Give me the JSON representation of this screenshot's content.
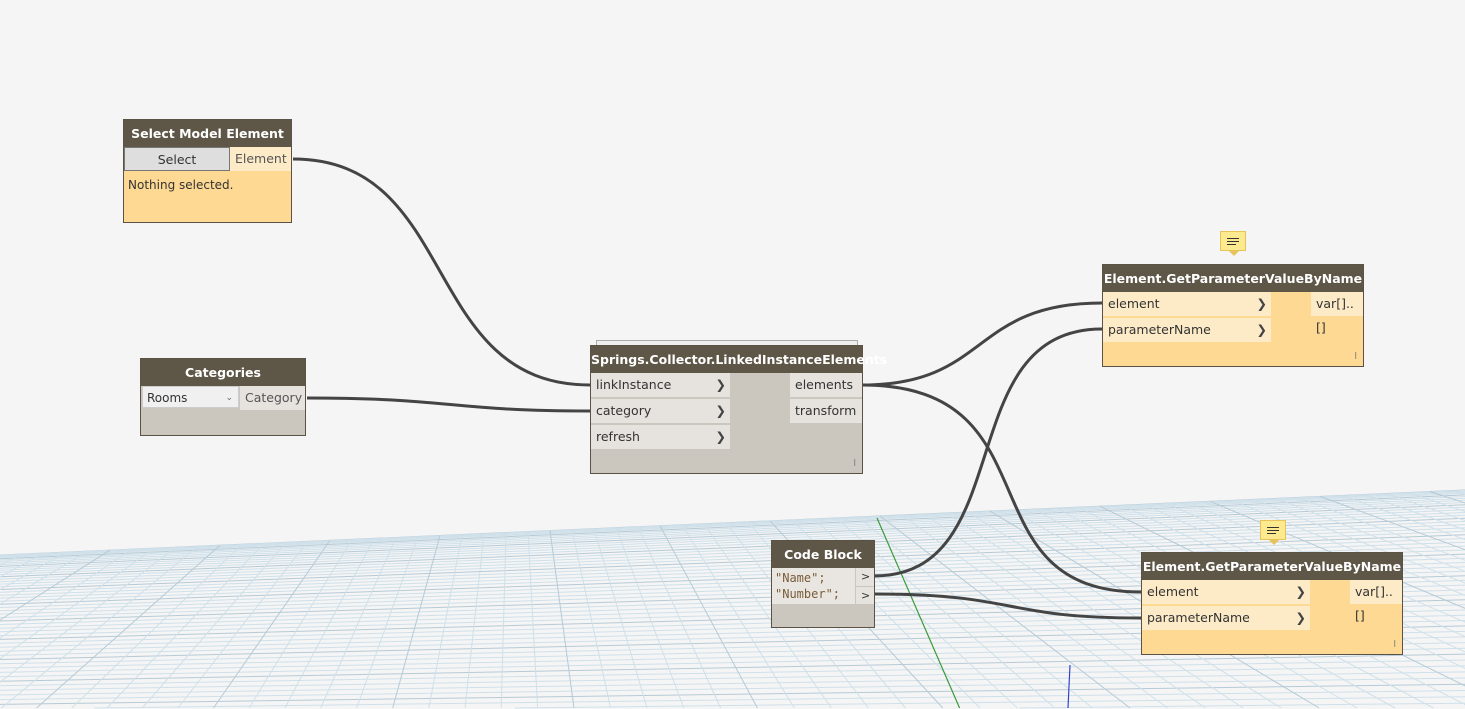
{
  "nodes": {
    "select_model": {
      "title": "Select Model Element",
      "button": "Select",
      "output": "Element",
      "status": "Nothing selected."
    },
    "categories": {
      "title": "Categories",
      "selected": "Rooms",
      "output": "Category"
    },
    "collector": {
      "title": "Springs.Collector.LinkedInstanceElements",
      "inputs": [
        "linkInstance",
        "category",
        "refresh"
      ],
      "outputs": [
        "elements",
        "transform"
      ],
      "lacing": "l"
    },
    "code_block": {
      "title": "Code Block",
      "lines": [
        "\"Name\";",
        "\"Number\";"
      ],
      "port": ">"
    },
    "get_param_1": {
      "title": "Element.GetParameterValueByName",
      "inputs": [
        "element",
        "parameterName"
      ],
      "output": "var[]..[]",
      "lacing": "l"
    },
    "get_param_2": {
      "title": "Element.GetParameterValueByName",
      "inputs": [
        "element",
        "parameterName"
      ],
      "output": "var[]..[]",
      "lacing": "l"
    }
  },
  "colors": {
    "header": "#5e5647",
    "node_yellow": "#fdd994",
    "node_gray": "#cbc6be",
    "wire": "#444444"
  }
}
